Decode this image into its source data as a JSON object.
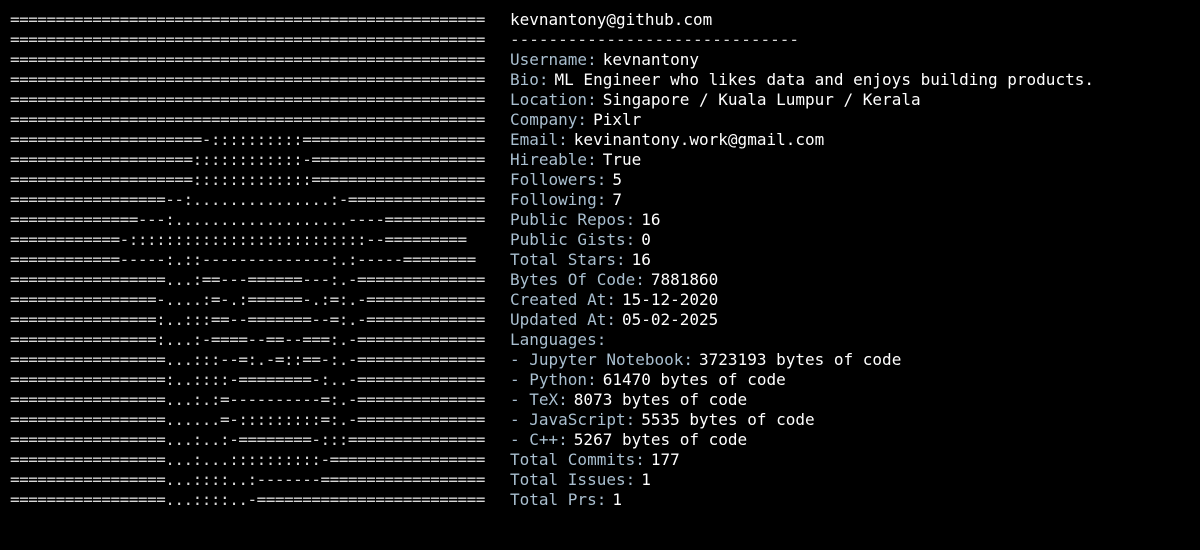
{
  "ascii_art": [
    "====================================================",
    "====================================================",
    "====================================================",
    "====================================================",
    "====================================================",
    "====================================================",
    "=====================-::::::::::====================",
    "====================::::::::::::-===================",
    "====================:::::::::::::===================",
    "=================--:...............:-===============",
    "==============---:...................----===========",
    "============-::::::::::::::::::::::::::--=========",
    "============-----:.::--------------:.:-----========",
    "=================...:==---======---:.-==============",
    "================-....:=-.:======-.:=:.-=============",
    "================:..:::==--=======--=:.-=============",
    "================:...:-====--==--===:.-==============",
    "=================...:::--=:.-=::==-:.-==============",
    "=================:..::::-========-:..-==============",
    "=================...:.:=----------=:.-==============",
    "=================......=-:::::::::=:.-==============",
    "=================...:..:-========-:::===============",
    "=================...:...::::::::::-=================",
    "=================...::::..:-------==================",
    "=================...::::..-========================="
  ],
  "profile": {
    "title": "kevnantony@github.com",
    "separator": "------------------------------",
    "fields": [
      {
        "key": "Username:",
        "value": "kevnantony"
      },
      {
        "key": "Bio:",
        "value": "ML Engineer who likes data and enjoys building products."
      },
      {
        "key": "Location:",
        "value": "Singapore / Kuala Lumpur / Kerala"
      },
      {
        "key": "Company:",
        "value": "Pixlr"
      },
      {
        "key": "Email:",
        "value": "kevinantony.work@gmail.com"
      },
      {
        "key": "Hireable:",
        "value": "True"
      },
      {
        "key": "Followers:",
        "value": "5"
      },
      {
        "key": "Following:",
        "value": "7"
      },
      {
        "key": "Public Repos:",
        "value": "16"
      },
      {
        "key": "Public Gists:",
        "value": "0"
      },
      {
        "key": "Total Stars:",
        "value": "16"
      },
      {
        "key": "Bytes Of Code:",
        "value": "7881860"
      },
      {
        "key": "Created At:",
        "value": "15-12-2020"
      },
      {
        "key": "Updated At:",
        "value": "05-02-2025"
      },
      {
        "key": "Languages:",
        "value": ""
      },
      {
        "key": "- Jupyter Notebook:",
        "value": "3723193 bytes of code"
      },
      {
        "key": "- Python:",
        "value": "61470 bytes of code"
      },
      {
        "key": "- TeX:",
        "value": "8073 bytes of code"
      },
      {
        "key": "- JavaScript:",
        "value": "5535 bytes of code"
      },
      {
        "key": "- C++:",
        "value": "5267 bytes of code"
      },
      {
        "key": "Total Commits:",
        "value": "177"
      },
      {
        "key": "Total Issues:",
        "value": "1"
      },
      {
        "key": "Total Prs:",
        "value": "1"
      }
    ]
  },
  "colors": {
    "background": "#000000",
    "key": "#a9bfd0",
    "value": "#ffffff",
    "ascii": "#d8d8d8"
  }
}
